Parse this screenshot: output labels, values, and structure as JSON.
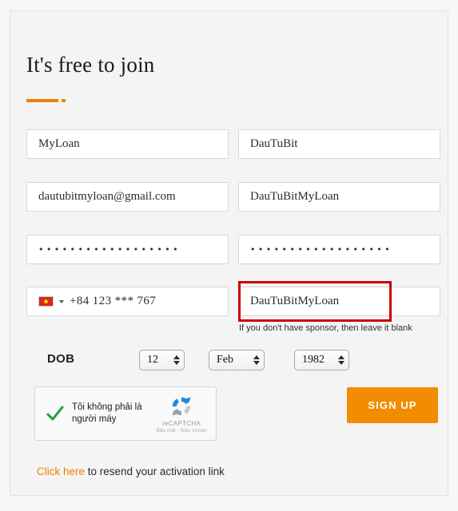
{
  "form": {
    "title": "It's free to join",
    "fields": {
      "first_name": "MyLoan",
      "last_name": "DauTuBit",
      "email": "dautubitmyloan@gmail.com",
      "username": "DauTuBitMyLoan",
      "password": "••••••••••••••••••",
      "confirm_password": "••••••••••••••••••",
      "phone_country_flag": "vietnam-flag",
      "phone_number": "+84 123 *** 767",
      "sponsor": "DauTuBitMyLoan"
    },
    "sponsor_helper_text": "If you don't have sponsor, then leave it blank",
    "dob": {
      "label": "DOB",
      "day": "12",
      "month": "Feb",
      "year": "1982"
    },
    "captcha": {
      "label": "Tôi không phải là người máy",
      "brand": "reCAPTCHA",
      "links": "Bảo mật - Điều khoản",
      "checked": true
    },
    "submit_label": "SIGN UP",
    "footer": {
      "link_text": "Click here",
      "rest_text": " to resend your activation link"
    }
  },
  "colors": {
    "accent": "#ef8000",
    "button": "#f28c00",
    "highlight_box": "#cc0000",
    "check": "#1b9f3e"
  }
}
